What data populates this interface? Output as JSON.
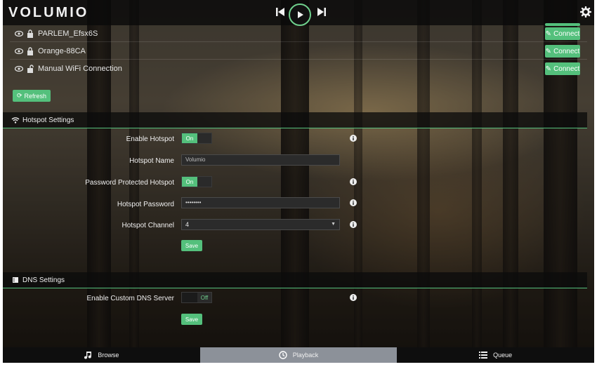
{
  "app": {
    "logo": "VOLUMIO"
  },
  "wifi": {
    "networks": [
      {
        "ssid": "PARLEM_Efsx6S",
        "connect_label": "Connect"
      },
      {
        "ssid": "Orange-88CA",
        "connect_label": "Connect"
      },
      {
        "ssid": "Manual WiFi Connection",
        "connect_label": "Connect"
      }
    ],
    "refresh_label": "Refresh"
  },
  "hotspot": {
    "title": "Hotspot Settings",
    "enable_label": "Enable Hotspot",
    "enable_value": "On",
    "name_label": "Hotspot Name",
    "name_value": "Volumio",
    "password_protected_label": "Password Protected Hotspot",
    "password_protected_value": "On",
    "password_label": "Hotspot Password",
    "password_value": "••••••••",
    "channel_label": "Hotspot Channel",
    "channel_value": "4",
    "save_label": "Save"
  },
  "dns": {
    "title": "DNS Settings",
    "custom_label": "Enable Custom DNS Server",
    "custom_value": "Off",
    "save_label": "Save"
  },
  "bottom_nav": {
    "browse": "Browse",
    "playback": "Playback",
    "queue": "Queue"
  },
  "colors": {
    "accent": "#54c07c",
    "bar": "#0e0e0e",
    "active_tab": "#8c9199"
  }
}
